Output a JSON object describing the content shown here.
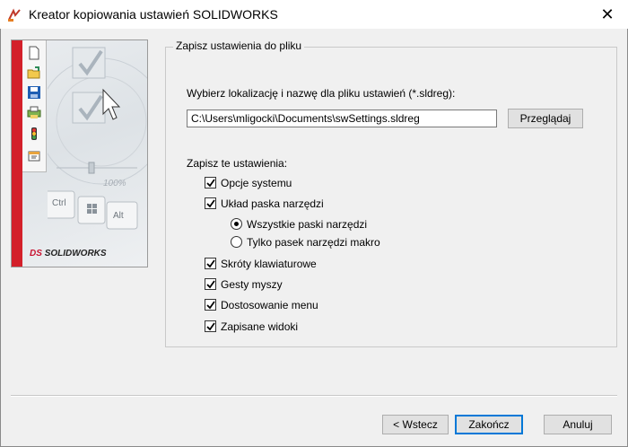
{
  "window": {
    "title": "Kreator kopiowania ustawień SOLIDWORKS",
    "close_glyph": "✕"
  },
  "banner": {
    "logo_prefix": "DS",
    "logo_text": "SOLIDWORKS",
    "key_labels": [
      "Ctrl",
      "Alt"
    ],
    "percent": "100%"
  },
  "group": {
    "title": "Zapisz ustawienia do pliku",
    "location_prompt": "Wybierz lokalizację i nazwę dla pliku ustawień (*.sldreg):",
    "path_value": "C:\\Users\\mligocki\\Documents\\swSettings.sldreg",
    "browse_label": "Przeglądaj",
    "save_prompt": "Zapisz te ustawienia:",
    "options": [
      {
        "label": "Opcje systemu",
        "checked": true
      },
      {
        "label": "Układ paska narzędzi",
        "checked": true
      },
      {
        "label": "Skróty klawiaturowe",
        "checked": true
      },
      {
        "label": "Gesty myszy",
        "checked": true
      },
      {
        "label": "Dostosowanie menu",
        "checked": true
      },
      {
        "label": "Zapisane widoki",
        "checked": true
      }
    ],
    "toolbar_layout": [
      {
        "label": "Wszystkie paski narzędzi",
        "selected": true
      },
      {
        "label": "Tylko pasek narzędzi makro",
        "selected": false
      }
    ]
  },
  "footer": {
    "back_label": "< Wstecz",
    "finish_label": "Zakończ",
    "cancel_label": "Anuluj"
  },
  "colors": {
    "accent": "#0078d7",
    "brand_red": "#d3202a"
  }
}
